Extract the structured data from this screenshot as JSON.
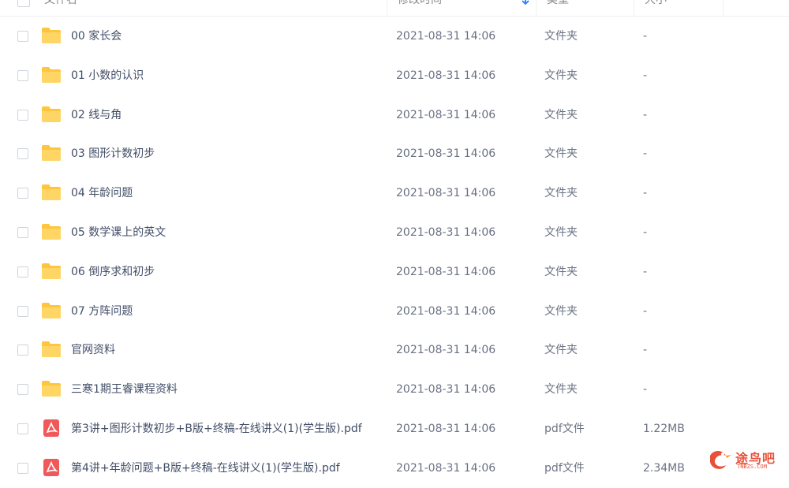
{
  "header": {
    "col_name": "文件名",
    "col_time": "修改时间",
    "col_type": "类型",
    "col_size": "大小"
  },
  "colors": {
    "folder": "#ffc53d",
    "pdf": "#f0585a",
    "sort_arrow": "#2f7cf6"
  },
  "files": [
    {
      "name": "00 家长会",
      "time": "2021-08-31 14:06",
      "type": "文件夹",
      "size": "-",
      "icon": "folder-icon"
    },
    {
      "name": "01 小数的认识",
      "time": "2021-08-31 14:06",
      "type": "文件夹",
      "size": "-",
      "icon": "folder-icon"
    },
    {
      "name": "02 线与角",
      "time": "2021-08-31 14:06",
      "type": "文件夹",
      "size": "-",
      "icon": "folder-icon"
    },
    {
      "name": "03 图形计数初步",
      "time": "2021-08-31 14:06",
      "type": "文件夹",
      "size": "-",
      "icon": "folder-icon"
    },
    {
      "name": "04 年龄问题",
      "time": "2021-08-31 14:06",
      "type": "文件夹",
      "size": "-",
      "icon": "folder-icon"
    },
    {
      "name": "05 数学课上的英文",
      "time": "2021-08-31 14:06",
      "type": "文件夹",
      "size": "-",
      "icon": "folder-icon"
    },
    {
      "name": "06 倒序求和初步",
      "time": "2021-08-31 14:06",
      "type": "文件夹",
      "size": "-",
      "icon": "folder-icon"
    },
    {
      "name": "07 方阵问题",
      "time": "2021-08-31 14:06",
      "type": "文件夹",
      "size": "-",
      "icon": "folder-icon"
    },
    {
      "name": "官网资料",
      "time": "2021-08-31 14:06",
      "type": "文件夹",
      "size": "-",
      "icon": "folder-icon"
    },
    {
      "name": "三寒1期王睿课程资料",
      "time": "2021-08-31 14:06",
      "type": "文件夹",
      "size": "-",
      "icon": "folder-icon"
    },
    {
      "name": "第3讲+图形计数初步+B版+终稿-在线讲义(1)(学生版).pdf",
      "time": "2021-08-31 14:06",
      "type": "pdf文件",
      "size": "1.22MB",
      "icon": "pdf-icon"
    },
    {
      "name": "第4讲+年龄问题+B版+终稿-在线讲义(1)(学生版).pdf",
      "time": "2021-08-31 14:06",
      "type": "pdf文件",
      "size": "2.34MB",
      "icon": "pdf-icon"
    }
  ],
  "watermark": {
    "text": "途鸟吧",
    "sub": "TNBZS.COM"
  }
}
